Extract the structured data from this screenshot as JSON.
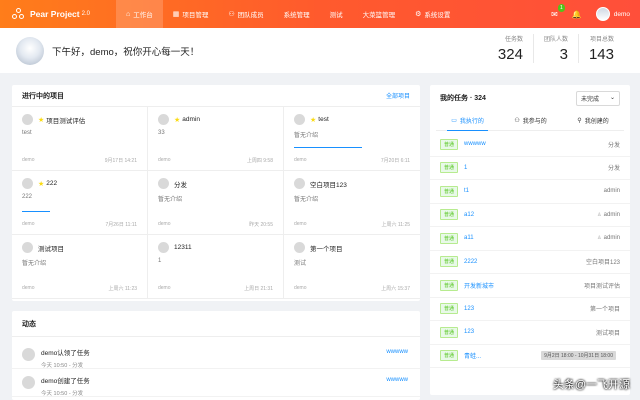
{
  "app": {
    "name": "Pear Project",
    "version": "2.0"
  },
  "nav": [
    {
      "label": "工作台",
      "icon": "home-icon",
      "active": true
    },
    {
      "label": "项目管理",
      "icon": "grid-icon"
    },
    {
      "label": "团队成员",
      "icon": "team-icon"
    },
    {
      "label": "系统管理",
      "icon": ""
    },
    {
      "label": "测试",
      "icon": ""
    },
    {
      "label": "大菜篮管理",
      "icon": ""
    },
    {
      "label": "系统设置",
      "icon": "gear-icon"
    }
  ],
  "topbar": {
    "notification_count": "1",
    "username": "demo"
  },
  "header": {
    "greeting": "下午好，demo，祝你开心每一天！",
    "stats": [
      {
        "label": "任务数",
        "value": "324"
      },
      {
        "label": "团队人数",
        "value": "3"
      },
      {
        "label": "项目总数",
        "value": "143"
      }
    ]
  },
  "projects": {
    "title": "进行中的项目",
    "all_link": "全部项目",
    "items": [
      {
        "name": "项目测试评估",
        "starred": true,
        "desc": "test",
        "owner": "demo",
        "time": "9月17日 14:21",
        "progress": 0
      },
      {
        "name": "admin",
        "starred": true,
        "desc": "33",
        "owner": "demo",
        "time": "上周四 9:58",
        "progress": 0
      },
      {
        "name": "test",
        "starred": true,
        "desc": "暂无介绍",
        "owner": "demo",
        "time": "7月20日 6:11",
        "progress": 0.68
      },
      {
        "name": "222",
        "starred": true,
        "desc": "222",
        "owner": "demo",
        "time": "7月26日 11:11",
        "progress": 0.28
      },
      {
        "name": "分发",
        "starred": false,
        "desc": "暂无介绍",
        "owner": "demo",
        "time": "昨天 20:55",
        "progress": 0
      },
      {
        "name": "空白项目123",
        "starred": false,
        "desc": "暂无介绍",
        "owner": "demo",
        "time": "上周六 11:25",
        "progress": 0
      },
      {
        "name": "测试项目",
        "starred": false,
        "desc": "暂无介绍",
        "owner": "demo",
        "time": "上周六 11:23",
        "progress": 0
      },
      {
        "name": "12311",
        "starred": false,
        "desc": "1",
        "owner": "demo",
        "time": "上周日 21:31",
        "progress": 0
      },
      {
        "name": "第一个项目",
        "starred": false,
        "desc": "测试",
        "owner": "demo",
        "time": "上周六 15:37",
        "progress": 0
      }
    ]
  },
  "activity": {
    "title": "动态",
    "items": [
      {
        "title": "demo认领了任务",
        "sub": "今天 10:50 - 分发",
        "link": "wwwww"
      },
      {
        "title": "demo创建了任务",
        "sub": "今天 10:50 - 分发",
        "link": "wwwww"
      }
    ]
  },
  "my_tasks": {
    "title": "我的任务 · 324",
    "filter": "未完成",
    "tabs": [
      "我执行的",
      "我参与的",
      "我创建的"
    ],
    "tag_label": "普通",
    "items": [
      {
        "name": "wwwww",
        "meta": "分发",
        "user_icon": false
      },
      {
        "name": "1",
        "meta": "分发",
        "user_icon": false
      },
      {
        "name": "t1",
        "meta": "admin",
        "user_icon": false
      },
      {
        "name": "a12",
        "meta": "admin",
        "user_icon": true
      },
      {
        "name": "a11",
        "meta": "admin",
        "user_icon": true
      },
      {
        "name": "2222",
        "meta": "空白项目123",
        "user_icon": false
      },
      {
        "name": "开发新城市",
        "meta": "项目测试评估",
        "user_icon": false
      },
      {
        "name": "123",
        "meta": "第一个项目",
        "user_icon": false
      },
      {
        "name": "123",
        "meta": "测试项目",
        "user_icon": false
      },
      {
        "name": "青蛙...",
        "meta": "",
        "date": "9月2日 18:00 - 10月31日 18:00",
        "user_icon": false
      }
    ]
  },
  "watermark": "头条@一飞开源",
  "colors": {
    "accent": "#1890ff",
    "topbar": "#ff5a2d",
    "tag": "#52c41a",
    "star": "#fadb14"
  }
}
